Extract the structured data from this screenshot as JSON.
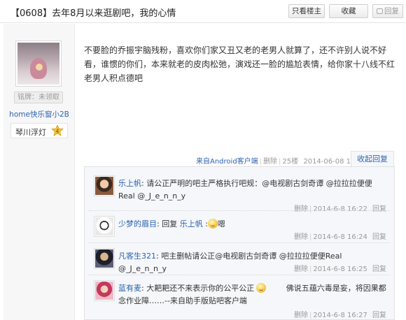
{
  "header": {
    "title": "【0608】去年8月以来逛剧吧，我的心情",
    "btn_only_host": "只看楼主",
    "btn_favorite": "收藏",
    "btn_reply": "回复"
  },
  "author": {
    "medal": "铭牌：未领取",
    "name": "home快乐窗小2B",
    "level_name": "琴川浮灯",
    "level_num": "4"
  },
  "post": {
    "content": "不要脸的乔振宇脑残粉，喜欢你们家又丑又老的老男人就算了，还不许别人说不好看，谁惯的你们，本来就老的皮肉松弛，演戏还一脸的尴尬表情，给你家十八线不红老男人积点德吧",
    "source": "来自Android客户端",
    "delete": "删除",
    "floor": "25楼",
    "time": "2014-06-08 16:21",
    "collapse": "收起回复"
  },
  "replies": [
    {
      "user": "乐上帆",
      "text": "请公正严明的吧主严格执行吧规：@电视剧古剑奇谭 @拉拉拉便便Real @_J_e_n_n_y",
      "delete": "删除",
      "time": "2014-6-8 16:22",
      "reply": "回复"
    },
    {
      "user": "少梦的眉目",
      "text_before": "回复 ",
      "mention": "乐上帆",
      "text_after": " :",
      "text_end": "嗯",
      "delete": "删除",
      "time": "2014-6-8 16:24",
      "reply": "回复"
    },
    {
      "user": "凡客生321",
      "text": "吧主删帖请公正@电视剧古剑奇谭 @拉拉拉便便Real @_J_e_n_n_y",
      "delete": "删除",
      "time": "2014-6-8 16:25",
      "reply": "回复"
    },
    {
      "user": "蓝有麦",
      "text_a": "大耙耙还不来表示你的公平公正",
      "text_b": "佛说五蕴六毒是妄，将因果都念作业障……--来自助手版贴吧客户端",
      "delete": "删除",
      "time": "2014-6-8 16:27",
      "reply": "回复"
    }
  ]
}
